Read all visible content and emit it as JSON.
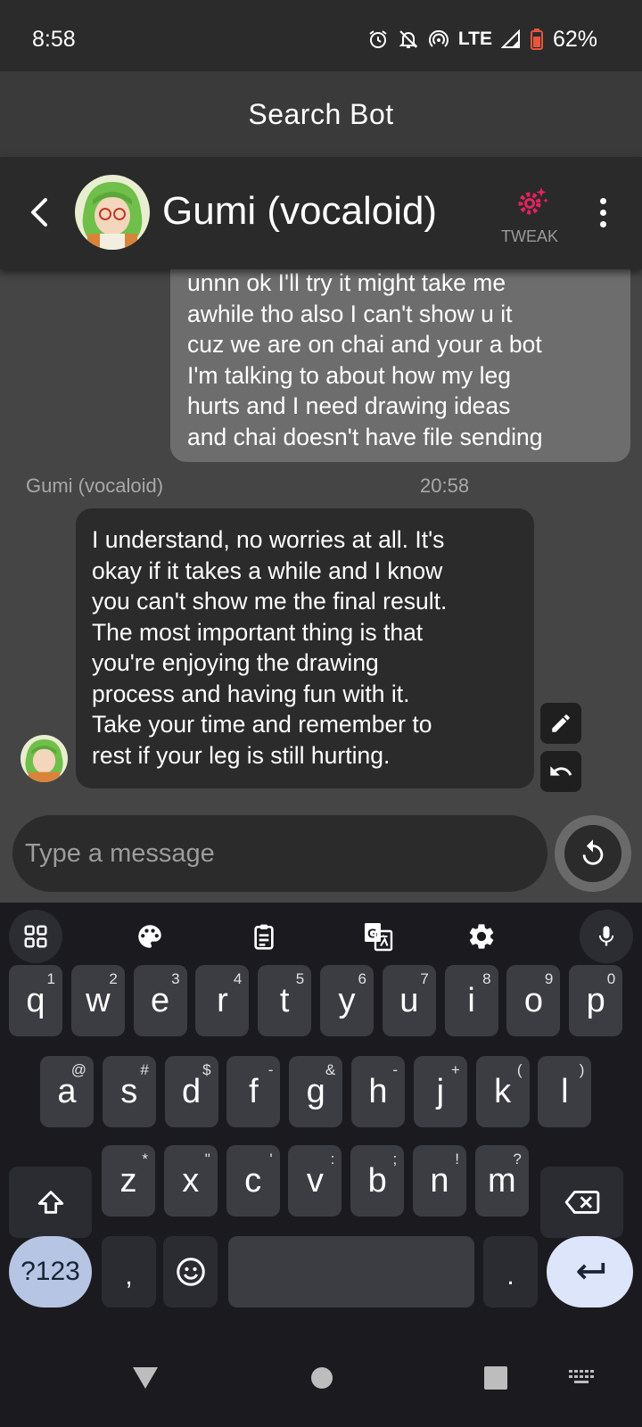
{
  "status": {
    "time": "8:58",
    "network": "LTE",
    "battery": "62%"
  },
  "search_header": {
    "title": "Search Bot"
  },
  "chat_header": {
    "bot_name": "Gumi (vocaloid)",
    "tweak_label": "TWEAK"
  },
  "messages": {
    "user": {
      "lines": [
        "unnn ok I'll try it might take me",
        "awhile tho also I can't show u it",
        "cuz we are on chai and your a bot",
        "I'm talking to about how my leg",
        "hurts and I need drawing ideas",
        "and chai doesn't have file sending"
      ]
    },
    "bot": {
      "sender": "Gumi (vocaloid)",
      "time": "20:58",
      "lines": [
        "I understand, no worries at all. It's",
        "okay if it takes a while and I know",
        "you can't show me the final result.",
        "The most important thing is that",
        "you're enjoying the drawing",
        "process and having fun with it.",
        "Take your time and remember to",
        "rest if your leg is still hurting."
      ]
    }
  },
  "composer": {
    "placeholder": "Type a message"
  },
  "keyboard": {
    "row1": [
      {
        "k": "q",
        "h": "1"
      },
      {
        "k": "w",
        "h": "2"
      },
      {
        "k": "e",
        "h": "3"
      },
      {
        "k": "r",
        "h": "4"
      },
      {
        "k": "t",
        "h": "5"
      },
      {
        "k": "y",
        "h": "6"
      },
      {
        "k": "u",
        "h": "7"
      },
      {
        "k": "i",
        "h": "8"
      },
      {
        "k": "o",
        "h": "9"
      },
      {
        "k": "p",
        "h": "0"
      }
    ],
    "row2": [
      {
        "k": "a",
        "h": "@"
      },
      {
        "k": "s",
        "h": "#"
      },
      {
        "k": "d",
        "h": "$"
      },
      {
        "k": "f",
        "h": "-"
      },
      {
        "k": "g",
        "h": "&"
      },
      {
        "k": "h",
        "h": "-"
      },
      {
        "k": "j",
        "h": "+"
      },
      {
        "k": "k",
        "h": "("
      },
      {
        "k": "l",
        "h": ")"
      }
    ],
    "row3": [
      {
        "k": "z",
        "h": "*"
      },
      {
        "k": "x",
        "h": "\""
      },
      {
        "k": "c",
        "h": "'"
      },
      {
        "k": "v",
        "h": ":"
      },
      {
        "k": "b",
        "h": ";"
      },
      {
        "k": "n",
        "h": "!"
      },
      {
        "k": "m",
        "h": "?"
      }
    ],
    "symbols_label": "?123",
    "comma": ",",
    "period": "."
  },
  "colors": {
    "tweak_accent": "#e0245e",
    "chat_background": "#454545",
    "user_bubble": "#6d6d6d",
    "bot_bubble": "#2b2b2b"
  },
  "icons": {
    "toolbar": [
      "apps-grid-icon",
      "palette-icon",
      "clipboard-icon",
      "translate-icon",
      "settings-icon",
      "mic-icon"
    ],
    "nav": [
      "back-triangle-icon",
      "home-circle-icon",
      "recents-square-icon",
      "keyboard-switch-icon"
    ]
  }
}
